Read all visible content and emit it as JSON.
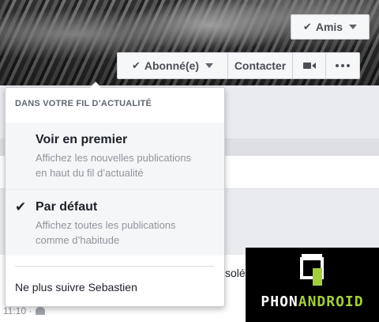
{
  "profile_header": {
    "amis_label": "Amis",
    "abonne_label": "Abonné(e)",
    "contacter_label": "Contacter"
  },
  "dropdown": {
    "header": "DANS VOTRE FIL D’ACTUALITÉ",
    "options": [
      {
        "title": "Voir en premier",
        "description_line1": "Affichez les nouvelles publications",
        "description_line2": "en haut du fil d’actualité",
        "selected": false
      },
      {
        "title": "Par défaut",
        "description_line1": "Affichez toutes les publications",
        "description_line2": "comme d’habitude",
        "selected": true
      }
    ],
    "unfollow_label": "Ne plus suivre Sebastien"
  },
  "background": {
    "post_fragment": "solé",
    "timestamp": "11:10 ·"
  },
  "watermark": {
    "part1": "PHON",
    "part2": "ANDROID"
  },
  "colors": {
    "watermark_green": "#a3cf3c",
    "button_bg": "#f6f7f9",
    "text_dark": "#1d2129",
    "text_muted": "#90949c"
  }
}
